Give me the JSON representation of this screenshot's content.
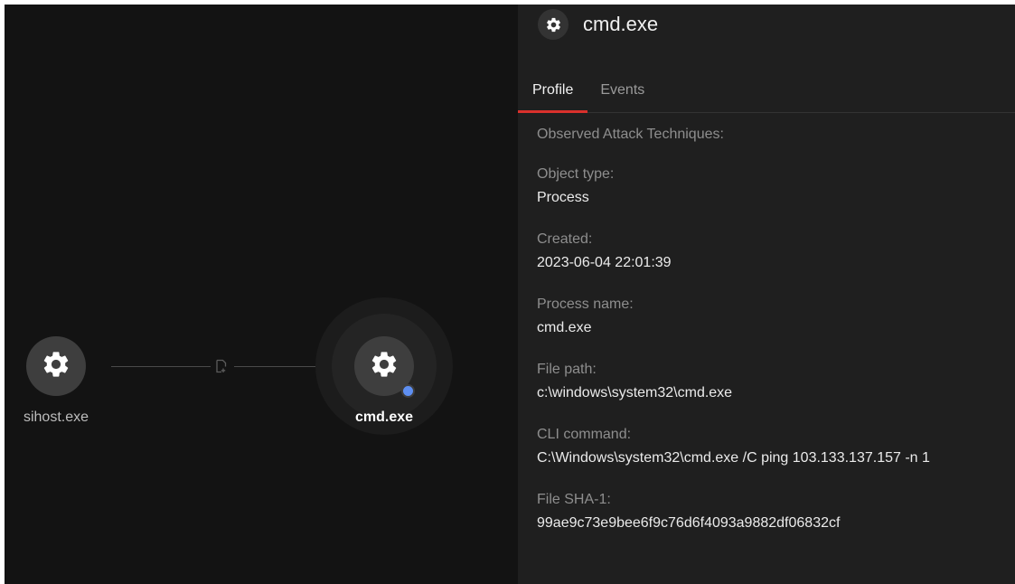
{
  "graph": {
    "nodes": [
      {
        "label": "sihost.exe",
        "icon": "gear-icon",
        "selected": false
      },
      {
        "label": "cmd.exe",
        "icon": "gear-icon",
        "selected": true,
        "badge_color": "#5e8ff2"
      }
    ],
    "edge": {
      "icon": "file-arrow-icon"
    }
  },
  "panel": {
    "icon": "gear-icon",
    "title": "cmd.exe",
    "tabs": [
      {
        "label": "Profile",
        "active": true
      },
      {
        "label": "Events",
        "active": false
      }
    ],
    "fields": [
      {
        "label": "Observed Attack Techniques:",
        "value": ""
      },
      {
        "label": "Object type:",
        "value": "Process"
      },
      {
        "label": "Created:",
        "value": "2023-06-04 22:01:39"
      },
      {
        "label": "Process name:",
        "value": "cmd.exe"
      },
      {
        "label": "File path:",
        "value": "c:\\windows\\system32\\cmd.exe"
      },
      {
        "label": "CLI command:",
        "value": "C:\\Windows\\system32\\cmd.exe /C ping 103.133.137.157 -n 1"
      },
      {
        "label": "File SHA-1:",
        "value": "99ae9c73e9bee6f9c76d6f4093a9882df06832cf"
      }
    ]
  },
  "colors": {
    "canvas_bg": "#131313",
    "panel_bg": "#1f1f1f",
    "active_tab_underline": "#d9302c",
    "node_badge": "#5e8ff2"
  }
}
